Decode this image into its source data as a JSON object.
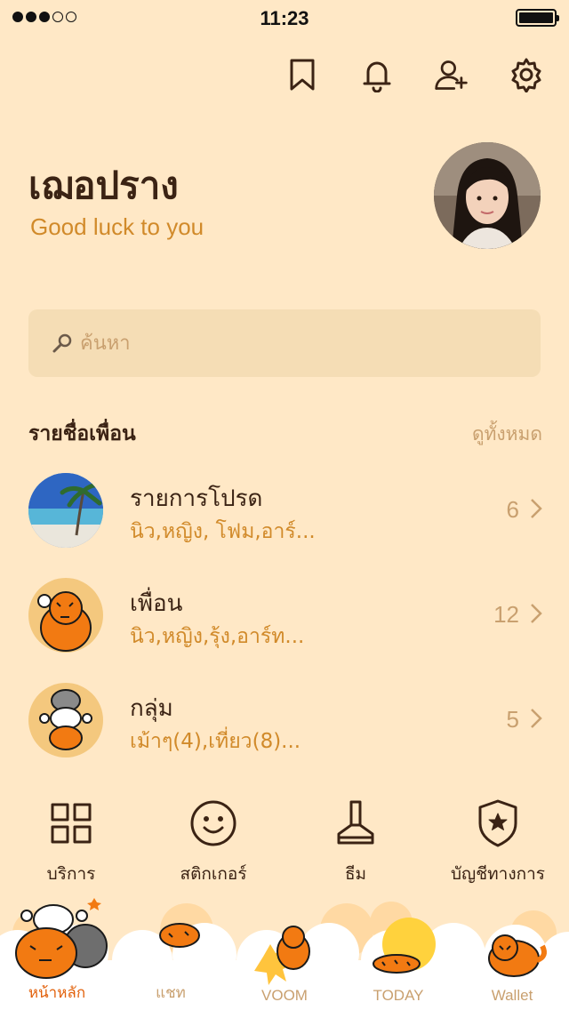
{
  "status_bar": {
    "time": "11:23"
  },
  "top_icons": [
    "bookmark-icon",
    "bell-icon",
    "add-friend-icon",
    "settings-icon"
  ],
  "profile": {
    "name": "เฌอปราง",
    "status": "Good luck to you"
  },
  "search": {
    "placeholder": "ค้นหา"
  },
  "friends": {
    "title": "รายชื่อเพื่อน",
    "view_all": "ดูทั้งหมด",
    "items": [
      {
        "title": "รายการโปรด",
        "subtitle": "นิว,หญิง, โฟม,อาร์...",
        "count": "6"
      },
      {
        "title": "เพื่อน",
        "subtitle": "นิว,หญิง,รุ้ง,อาร์ท...",
        "count": "12"
      },
      {
        "title": "กลุ่ม",
        "subtitle": "เม้าๆ(4),เที่ยว(8)...",
        "count": "5"
      }
    ]
  },
  "services": [
    {
      "label": "บริการ",
      "icon": "grid-icon"
    },
    {
      "label": "สติกเกอร์",
      "icon": "smiley-icon"
    },
    {
      "label": "ธีม",
      "icon": "brush-icon"
    },
    {
      "label": "บัญชีทางการ",
      "icon": "shield-star-icon"
    }
  ],
  "tabs": [
    {
      "label": "หน้าหลัก",
      "active": true
    },
    {
      "label": "แชท",
      "active": false
    },
    {
      "label": "VOOM",
      "active": false
    },
    {
      "label": "TODAY",
      "active": false
    },
    {
      "label": "Wallet",
      "active": false
    }
  ],
  "colors": {
    "background": "#FFE8C6",
    "accent": "#D18A2A",
    "active_tab": "#E2600A",
    "text": "#3B2314"
  }
}
